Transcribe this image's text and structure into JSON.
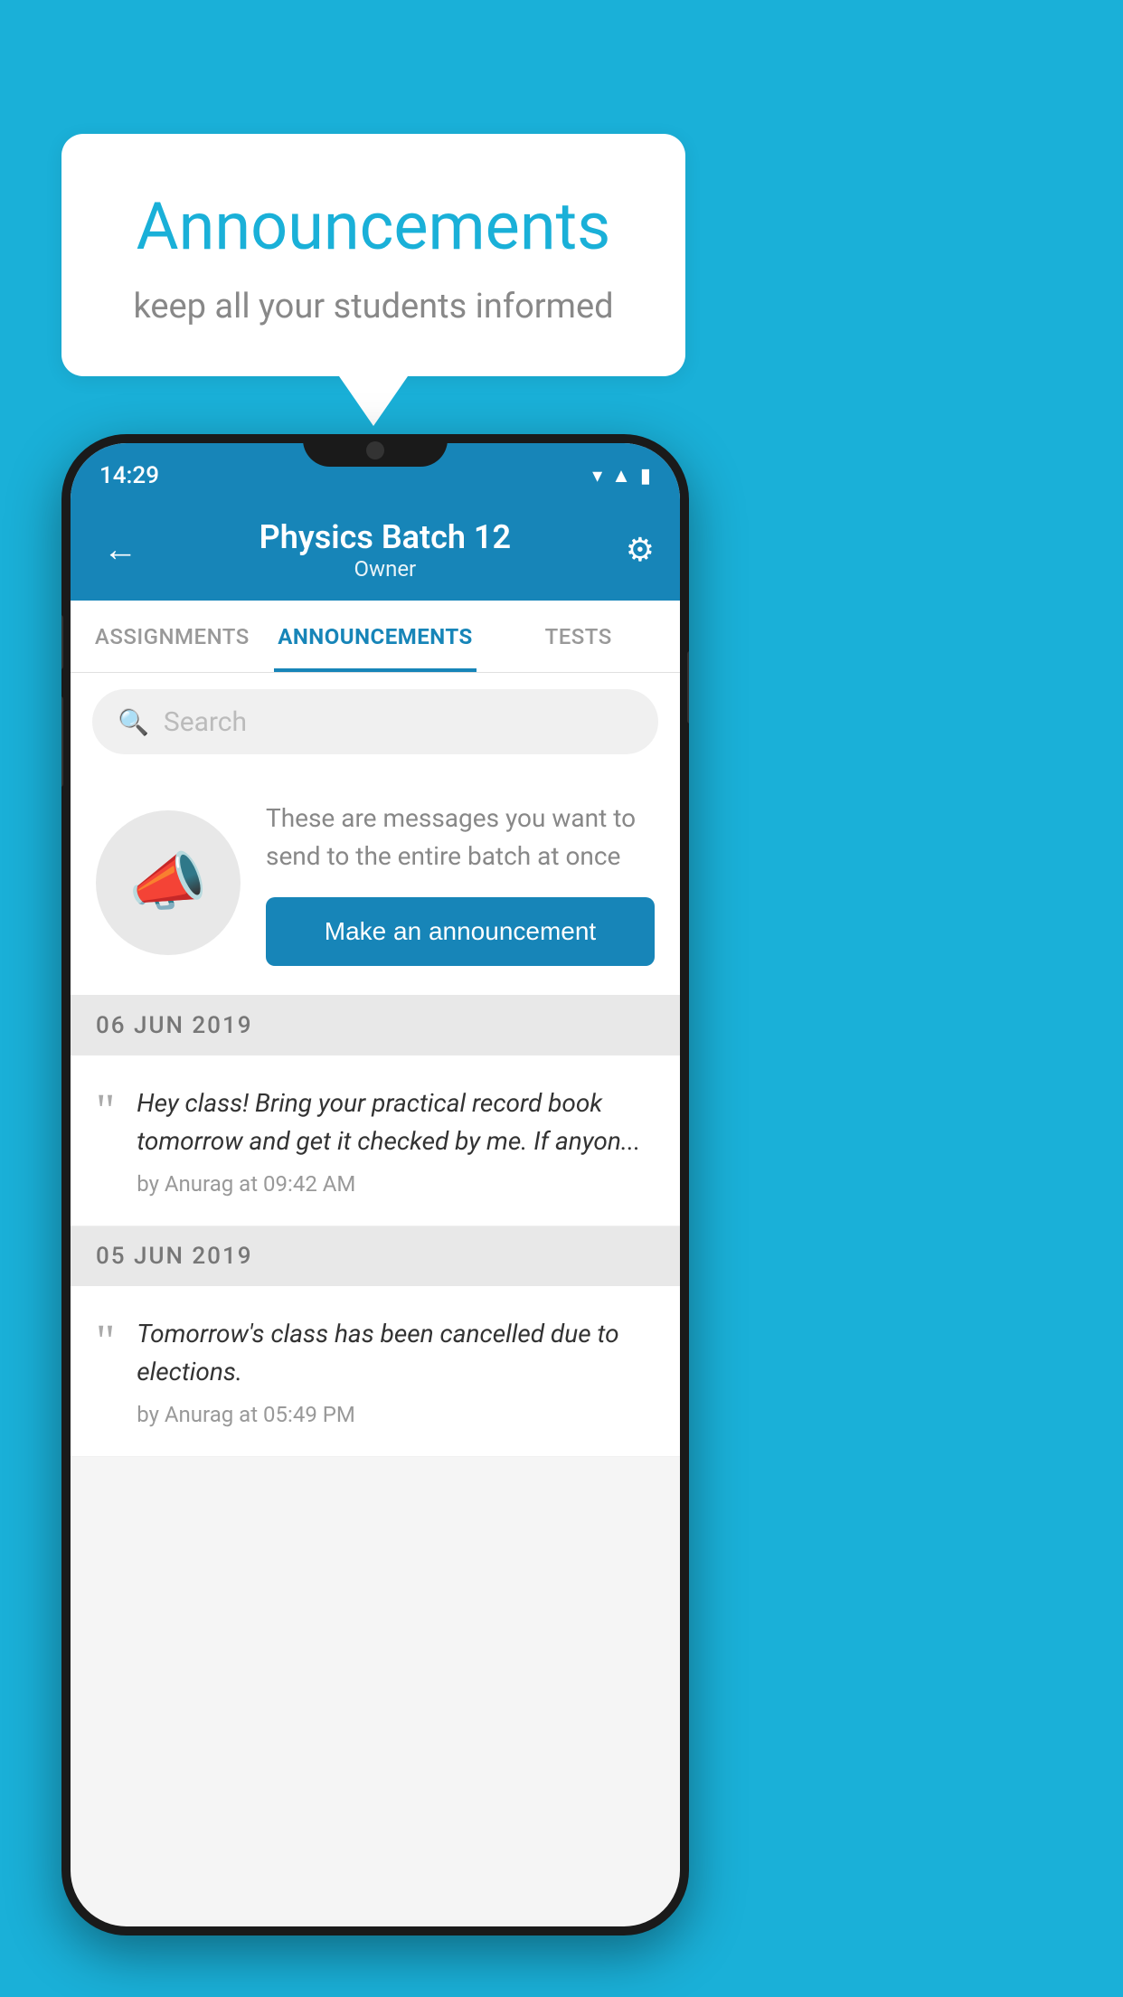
{
  "background_color": "#1ab0d8",
  "speech_bubble": {
    "title": "Announcements",
    "subtitle": "keep all your students informed"
  },
  "phone": {
    "status_bar": {
      "time": "14:29",
      "icons": [
        "wifi",
        "signal",
        "battery"
      ]
    },
    "header": {
      "title": "Physics Batch 12",
      "subtitle": "Owner",
      "back_label": "←"
    },
    "tabs": [
      {
        "label": "ASSIGNMENTS",
        "active": false
      },
      {
        "label": "ANNOUNCEMENTS",
        "active": true
      },
      {
        "label": "TESTS",
        "active": false
      }
    ],
    "search": {
      "placeholder": "Search"
    },
    "promo": {
      "description": "These are messages you want to send to the entire batch at once",
      "button_label": "Make an announcement"
    },
    "announcements": [
      {
        "date": "06  JUN  2019",
        "text": "Hey class! Bring your practical record book tomorrow and get it checked by me. If anyon...",
        "meta": "by Anurag at 09:42 AM"
      },
      {
        "date": "05  JUN  2019",
        "text": "Tomorrow's class has been cancelled due to elections.",
        "meta": "by Anurag at 05:49 PM"
      }
    ]
  }
}
